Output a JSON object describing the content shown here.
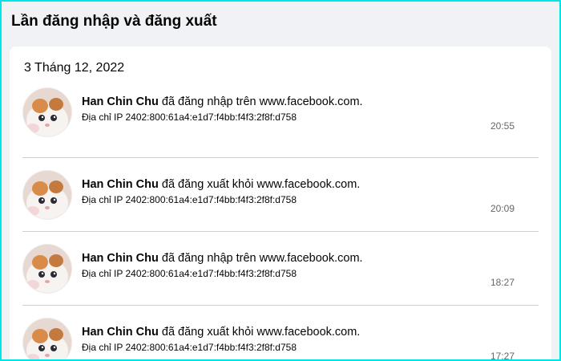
{
  "page": {
    "title": "Lần đăng nhập và đăng xuất"
  },
  "section": {
    "date": "3 Tháng 12, 2022",
    "entries": [
      {
        "name": "Han Chin Chu",
        "action": "đã đăng nhập trên www.facebook.com.",
        "ip": "Địa chỉ IP 2402:800:61a4:e1d7:f4bb:f4f3:2f8f:d758",
        "time": "20:55"
      },
      {
        "name": "Han Chin Chu",
        "action": "đã đăng xuất khỏi www.facebook.com.",
        "ip": "Địa chỉ IP 2402:800:61a4:e1d7:f4bb:f4f3:2f8f:d758",
        "time": "20:09"
      },
      {
        "name": "Han Chin Chu",
        "action": "đã đăng nhập trên www.facebook.com.",
        "ip": "Địa chỉ IP 2402:800:61a4:e1d7:f4bb:f4f3:2f8f:d758",
        "time": "18:27"
      },
      {
        "name": "Han Chin Chu",
        "action": "đã đăng xuất khỏi www.facebook.com.",
        "ip": "Địa chỉ IP 2402:800:61a4:e1d7:f4bb:f4f3:2f8f:d758",
        "time": "17:27"
      }
    ]
  },
  "icons": {
    "avatar": "profile-photo-cat"
  },
  "colors": {
    "frame_border": "#00e5e5",
    "background": "#f0f2f5",
    "card": "#ffffff",
    "secondary_text": "#65676b"
  }
}
